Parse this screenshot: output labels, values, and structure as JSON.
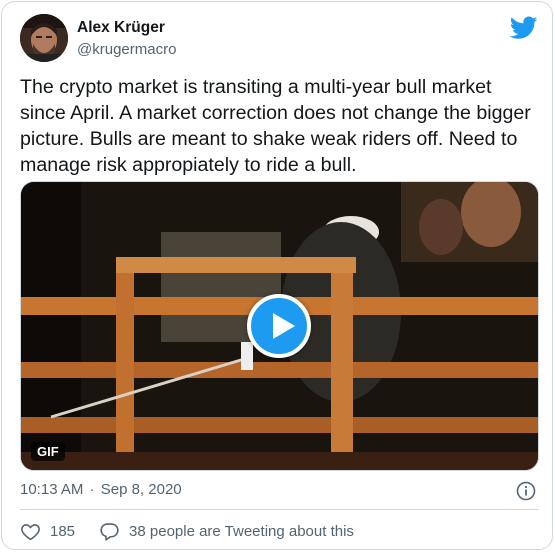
{
  "author": {
    "name": "Alex Krüger",
    "handle": "@krugermacro"
  },
  "tweet": {
    "text": "The crypto market is transiting a multi-year bull market since April. A market correction does not change the bigger picture. Bulls are meant to shake weak riders off. Need to manage risk appropiately to ride a bull.",
    "media_badge": "GIF",
    "time": "10:13 AM",
    "separator": "·",
    "date": "Sep 8, 2020"
  },
  "actions": {
    "like_count": "185",
    "tweeting_text": "38 people are Tweeting about this"
  },
  "icons": {
    "brand": "twitter-bird-icon",
    "play": "play-icon",
    "info": "info-icon",
    "like": "heart-icon",
    "reply": "speech-bubble-icon"
  },
  "colors": {
    "accent": "#1d9bf0",
    "text": "#14171a",
    "muted": "#536471",
    "border": "#cfd9de"
  }
}
